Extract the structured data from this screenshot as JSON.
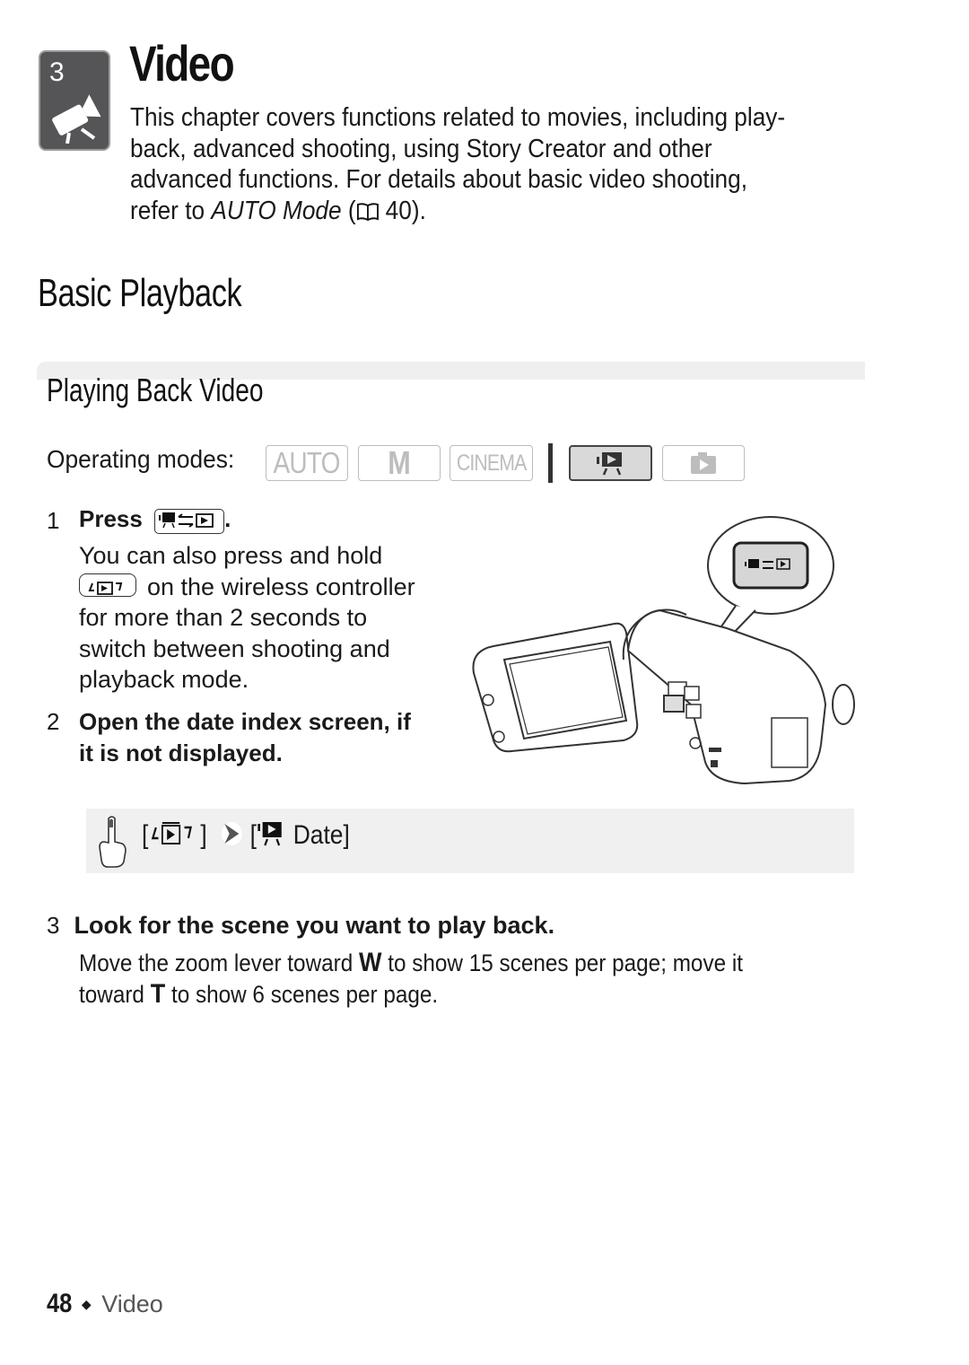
{
  "chapter": {
    "number": "3",
    "icon": "video-camera-icon",
    "title": "Video",
    "intro_lines": [
      "This chapter covers functions related to movies, including play-",
      "back, advanced shooting, using Story Creator and other",
      "advanced functions. For details about basic video shooting,"
    ],
    "intro_ref_prefix": "refer to ",
    "intro_ref_italic": "AUTO Mode",
    "intro_ref_open": " (",
    "intro_ref_icon": "book-icon",
    "intro_ref_page": " 40)."
  },
  "section": {
    "title": "Basic Playback",
    "subsection_title": "Playing Back Video"
  },
  "operating_modes": {
    "label": "Operating modes:",
    "modes": [
      {
        "label": "AUTO",
        "active": false
      },
      {
        "label": "M",
        "active": false
      },
      {
        "label": "CINEMA",
        "active": false
      },
      {
        "label": "video-playback-icon",
        "active": true
      },
      {
        "label": "photo-playback-icon",
        "active": false
      }
    ]
  },
  "steps": [
    {
      "number": "1",
      "heading": "Press",
      "heading_key": "camera-play-toggle-key",
      "heading_end": ".",
      "body_lines": [
        "You can also press and hold",
        "on the wireless controller",
        "for more than 2 seconds to",
        "switch between shooting and",
        "playback mode."
      ],
      "body_key": "wireless-playback-key"
    },
    {
      "number": "2",
      "heading_lines": [
        "Open the date index screen, if",
        "it is not displayed."
      ]
    },
    {
      "number": "3",
      "heading": "Look for the scene you want to play back.",
      "body_part1": "Move the zoom lever toward ",
      "body_W": "W",
      "body_part2": " to show 15 scenes per page; move it",
      "body_part3": "toward ",
      "body_T": "T",
      "body_part4": " to show 6 scenes per page."
    }
  ],
  "touch_nav": {
    "icon": "touch-finger-icon",
    "open_bracket": "[",
    "close_bracket": "]",
    "arrow_icon": "chevron-right-icon",
    "date_label": "Date]",
    "date_open": "["
  },
  "illustration": {
    "alt": "Camcorder with LCD panel open, callout highlighting the camera/play mode button"
  },
  "footer": {
    "page_number": "48",
    "separator": "◆",
    "section": "Video"
  }
}
